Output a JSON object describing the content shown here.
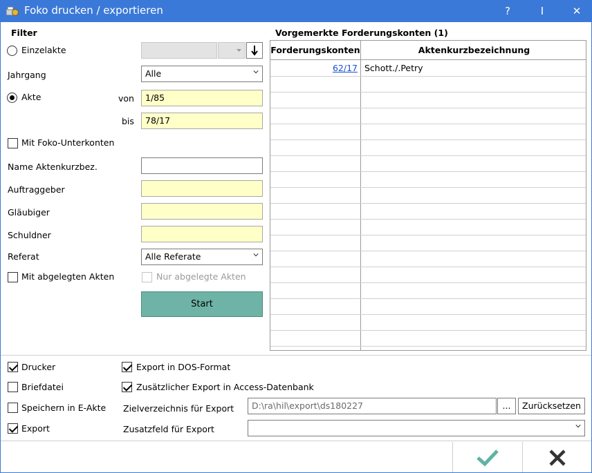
{
  "window": {
    "title": "Foko drucken / exportieren",
    "help_label": "?",
    "info_label": "I",
    "close_label": "✕"
  },
  "filter": {
    "heading": "Filter",
    "einzelakte_label": "Einzelakte",
    "jahrgang_label": "Jahrgang",
    "jahrgang_value": "Alle",
    "akte_label": "Akte",
    "von_label": "von",
    "von_value": "1/85",
    "bis_label": "bis",
    "bis_value": "78/17",
    "mit_foko_label": "Mit Foko-Unterkonten",
    "name_label": "Name Aktenkurzbez.",
    "name_value": "",
    "auftraggeber_label": "Auftraggeber",
    "glaeubiger_label": "Gläubiger",
    "schuldner_label": "Schuldner",
    "referat_label": "Referat",
    "referat_value": "Alle Referate",
    "mit_abgelegten_label": "Mit abgelegten Akten",
    "nur_abgelegte_label": "Nur abgelegte Akten",
    "start_label": "Start"
  },
  "grid": {
    "heading": "Vorgemerkte Forderungskonten (1)",
    "col1": "Forderungskonten",
    "col2": "Aktenkurzbezeichnung",
    "rows": [
      {
        "konto": "62/17",
        "bez": "Schott./.Petry"
      }
    ]
  },
  "output": {
    "drucker_label": "Drucker",
    "briefdatei_label": "Briefdatei",
    "speichern_label": "Speichern in E-Akte",
    "export_label": "Export",
    "dos_label": "Export in DOS-Format",
    "access_label": "Zusätzlicher Export in Access-Datenbank",
    "zielverzeichnis_label": "Zielverzeichnis für Export",
    "zielverzeichnis_value": "D:\\ra\\hil\\export\\ds180227",
    "browse_label": "...",
    "reset_label": "Zurücksetzen",
    "zusatzfeld_label": "Zusatzfeld für Export",
    "zusatzfeld_value": ""
  },
  "colors": {
    "titlebar": "#3b79d8",
    "start_button": "#6fb3a7",
    "required_field": "#ffffc8",
    "ok_check": "#5fb3a5",
    "cancel_x": "#333333"
  },
  "state": {
    "einzelakte": false,
    "akte": true,
    "mit_foko": false,
    "mit_abgelegten": false,
    "nur_abgelegte": false,
    "drucker": true,
    "briefdatei": false,
    "speichern": false,
    "export": true,
    "dos": true,
    "access": true
  }
}
